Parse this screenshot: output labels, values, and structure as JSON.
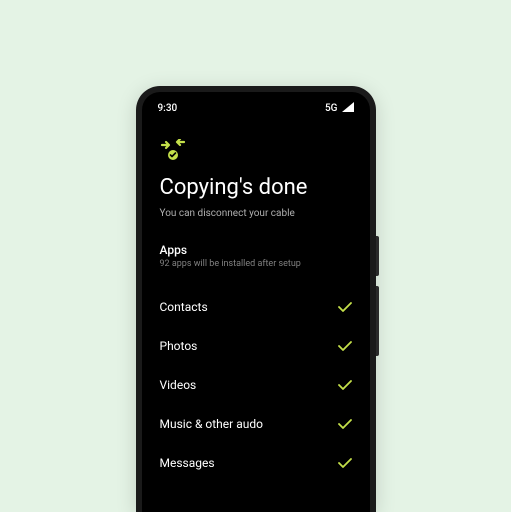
{
  "status_bar": {
    "time": "9:30",
    "network_label": "5G"
  },
  "header": {
    "title": "Copying's done",
    "subtitle": "You can disconnect your cable"
  },
  "apps_section": {
    "title": "Apps",
    "subtitle": "92 apps will be installed after setup"
  },
  "items": [
    {
      "label": "Contacts"
    },
    {
      "label": "Photos"
    },
    {
      "label": "Videos"
    },
    {
      "label": "Music & other audo"
    },
    {
      "label": "Messages"
    }
  ],
  "colors": {
    "accent": "#c4e04a"
  }
}
